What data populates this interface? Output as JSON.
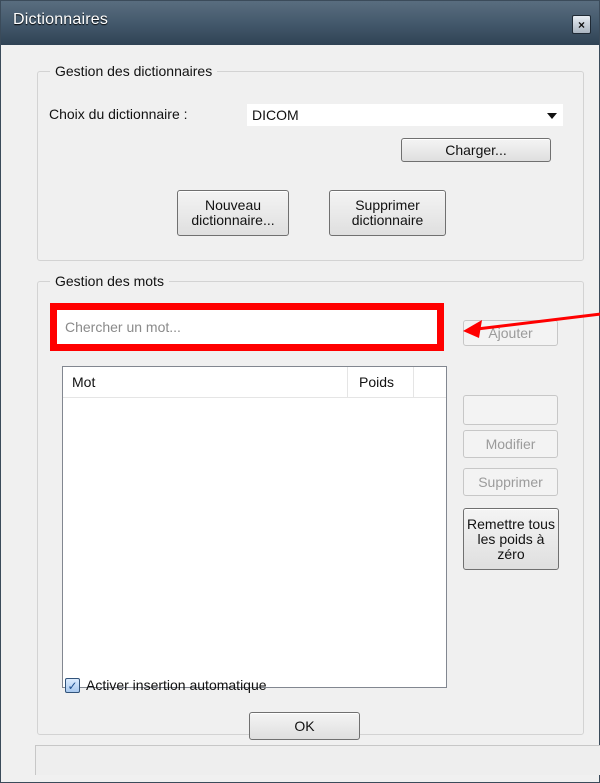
{
  "window": {
    "title": "Dictionnaires",
    "close_glyph": "×"
  },
  "dictionary_group": {
    "title": "Gestion des dictionnaires",
    "choice_label": "Choix du dictionnaire :",
    "selected_dictionary": "DICOM",
    "buttons": {
      "load": "Charger...",
      "new": "Nouveau dictionnaire...",
      "delete": "Supprimer dictionnaire"
    }
  },
  "words_group": {
    "title": "Gestion des mots",
    "search": {
      "value": "",
      "placeholder": "Chercher un mot..."
    },
    "buttons": {
      "add": "Ajouter",
      "blank": "",
      "modify": "Modifier",
      "delete": "Supprimer",
      "reset_weights": "Remettre tous les poids à zéro"
    },
    "list": {
      "columns": [
        "Mot",
        "Poids"
      ],
      "rows": []
    },
    "auto_insert": {
      "label": "Activer insertion automatique",
      "checked": true,
      "check_glyph": "✓"
    }
  },
  "dialog": {
    "ok": "OK"
  },
  "colors": {
    "highlight": "#ff0000",
    "titlebar": "#43586b"
  },
  "icons": {
    "close": "close-icon",
    "dropdown": "chevron-down-icon",
    "checkbox": "check-icon",
    "annotation_arrow": "red-arrow-icon"
  }
}
